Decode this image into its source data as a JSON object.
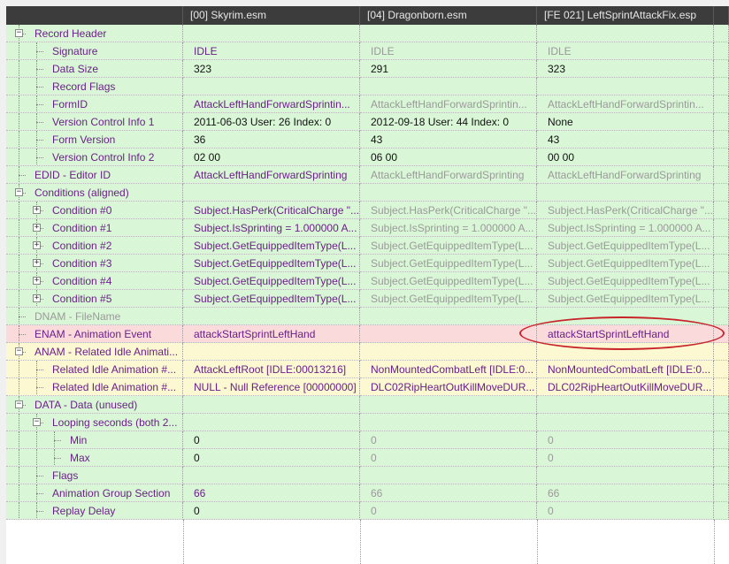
{
  "columns": [
    "",
    "[00] Skyrim.esm",
    "[04] Dragonborn.esm",
    "[FE 021] LeftSprintAttackFix.esp"
  ],
  "rows": [
    {
      "label": "Record Header",
      "indent": 0,
      "expander": "minus",
      "bg": "#d9f7d6",
      "colors": [
        "purple",
        "purple",
        "purple"
      ],
      "values": [
        "",
        "",
        ""
      ]
    },
    {
      "label": "Signature",
      "indent": 1,
      "expander": "none",
      "bg": "#d9f7d6",
      "colors": [
        "purple",
        "grey",
        "grey"
      ],
      "values": [
        "IDLE",
        "IDLE",
        "IDLE"
      ]
    },
    {
      "label": "Data Size",
      "indent": 1,
      "expander": "none",
      "bg": "#d9f7d6",
      "colors": [
        "black",
        "black",
        "black"
      ],
      "values": [
        "323",
        "291",
        "323"
      ]
    },
    {
      "label": "Record Flags",
      "indent": 1,
      "expander": "none",
      "bg": "#d9f7d6",
      "colors": [
        "purple",
        "purple",
        "purple"
      ],
      "values": [
        "",
        "",
        ""
      ]
    },
    {
      "label": "FormID",
      "indent": 1,
      "expander": "none",
      "bg": "#d9f7d6",
      "colors": [
        "purple",
        "grey",
        "grey"
      ],
      "values": [
        "AttackLeftHandForwardSprintin...",
        "AttackLeftHandForwardSprintin...",
        "AttackLeftHandForwardSprintin..."
      ]
    },
    {
      "label": "Version Control Info 1",
      "indent": 1,
      "expander": "none",
      "bg": "#d9f7d6",
      "colors": [
        "black",
        "black",
        "black"
      ],
      "values": [
        "2011-06-03 User: 26 Index: 0",
        "2012-09-18 User: 44 Index: 0",
        "None"
      ]
    },
    {
      "label": "Form Version",
      "indent": 1,
      "expander": "none",
      "bg": "#d9f7d6",
      "colors": [
        "black",
        "black",
        "black"
      ],
      "values": [
        "36",
        "43",
        "43"
      ]
    },
    {
      "label": "Version Control Info 2",
      "indent": 1,
      "expander": "none",
      "bg": "#d9f7d6",
      "colors": [
        "black",
        "black",
        "black"
      ],
      "values": [
        "02 00",
        "06 00",
        "00 00"
      ]
    },
    {
      "label": "EDID - Editor ID",
      "indent": 0,
      "expander": "none",
      "bg": "#d9f7d6",
      "colors": [
        "purple",
        "grey",
        "grey"
      ],
      "values": [
        "AttackLeftHandForwardSprinting",
        "AttackLeftHandForwardSprinting",
        "AttackLeftHandForwardSprinting"
      ]
    },
    {
      "label": "Conditions (aligned)",
      "indent": 0,
      "expander": "minus",
      "bg": "#d9f7d6",
      "colors": [
        "purple",
        "purple",
        "purple"
      ],
      "values": [
        "",
        "",
        ""
      ]
    },
    {
      "label": "Condition #0",
      "indent": 1,
      "expander": "plus",
      "bg": "#d9f7d6",
      "colors": [
        "purple",
        "grey",
        "grey"
      ],
      "values": [
        "Subject.HasPerk(CriticalCharge \"...",
        "Subject.HasPerk(CriticalCharge \"...",
        "Subject.HasPerk(CriticalCharge \"..."
      ]
    },
    {
      "label": "Condition #1",
      "indent": 1,
      "expander": "plus",
      "bg": "#d9f7d6",
      "colors": [
        "purple",
        "grey",
        "grey"
      ],
      "values": [
        "Subject.IsSprinting = 1.000000 A...",
        "Subject.IsSprinting = 1.000000 A...",
        "Subject.IsSprinting = 1.000000 A..."
      ]
    },
    {
      "label": "Condition #2",
      "indent": 1,
      "expander": "plus",
      "bg": "#d9f7d6",
      "colors": [
        "purple",
        "grey",
        "grey"
      ],
      "values": [
        "Subject.GetEquippedItemType(L...",
        "Subject.GetEquippedItemType(L...",
        "Subject.GetEquippedItemType(L..."
      ]
    },
    {
      "label": "Condition #3",
      "indent": 1,
      "expander": "plus",
      "bg": "#d9f7d6",
      "colors": [
        "purple",
        "grey",
        "grey"
      ],
      "values": [
        "Subject.GetEquippedItemType(L...",
        "Subject.GetEquippedItemType(L...",
        "Subject.GetEquippedItemType(L..."
      ]
    },
    {
      "label": "Condition #4",
      "indent": 1,
      "expander": "plus",
      "bg": "#d9f7d6",
      "colors": [
        "purple",
        "grey",
        "grey"
      ],
      "values": [
        "Subject.GetEquippedItemType(L...",
        "Subject.GetEquippedItemType(L...",
        "Subject.GetEquippedItemType(L..."
      ]
    },
    {
      "label": "Condition #5",
      "indent": 1,
      "expander": "plus",
      "bg": "#d9f7d6",
      "colors": [
        "purple",
        "grey",
        "grey"
      ],
      "values": [
        "Subject.GetEquippedItemType(L...",
        "Subject.GetEquippedItemType(L...",
        "Subject.GetEquippedItemType(L..."
      ]
    },
    {
      "label": "DNAM - FileName",
      "indent": 0,
      "expander": "none",
      "bg": "#d9f7d6",
      "labelColor": "#9a9a9a",
      "colors": [
        "purple",
        "purple",
        "purple"
      ],
      "values": [
        "",
        "",
        ""
      ]
    },
    {
      "label": "ENAM - Animation Event",
      "indent": 0,
      "expander": "none",
      "bg": "#fadadb",
      "colors": [
        "purple",
        "purple",
        "purple"
      ],
      "values": [
        "attackStartSprintLeftHand",
        "",
        "attackStartSprintLeftHand"
      ]
    },
    {
      "label": "ANAM - Related Idle Animati...",
      "indent": 0,
      "expander": "minus",
      "bg": "#fbf8d2",
      "colors": [
        "purple",
        "purple",
        "purple"
      ],
      "values": [
        "",
        "",
        ""
      ]
    },
    {
      "label": "Related Idle Animation #...",
      "indent": 1,
      "expander": "none",
      "bg": "#fbf8d2",
      "colors": [
        "purple",
        "purple",
        "purple"
      ],
      "values": [
        "AttackLeftRoot [IDLE:00013216]",
        "NonMountedCombatLeft [IDLE:0...",
        "NonMountedCombatLeft [IDLE:0..."
      ]
    },
    {
      "label": "Related Idle Animation #...",
      "indent": 1,
      "expander": "none",
      "bg": "#fbf8d2",
      "colors": [
        "purple",
        "purple",
        "purple"
      ],
      "values": [
        "NULL - Null Reference [00000000]",
        "DLC02RipHeartOutKillMoveDUR...",
        "DLC02RipHeartOutKillMoveDUR..."
      ]
    },
    {
      "label": "DATA - Data (unused)",
      "indent": 0,
      "expander": "minus",
      "bg": "#d9f7d6",
      "colors": [
        "purple",
        "purple",
        "purple"
      ],
      "values": [
        "",
        "",
        ""
      ]
    },
    {
      "label": "Looping seconds (both 2...",
      "indent": 1,
      "expander": "minus",
      "bg": "#d9f7d6",
      "colors": [
        "purple",
        "purple",
        "purple"
      ],
      "values": [
        "",
        "",
        ""
      ]
    },
    {
      "label": "Min",
      "indent": 2,
      "expander": "none",
      "bg": "#d9f7d6",
      "colors": [
        "black",
        "grey",
        "grey"
      ],
      "values": [
        "0",
        "0",
        "0"
      ]
    },
    {
      "label": "Max",
      "indent": 2,
      "expander": "none",
      "bg": "#d9f7d6",
      "colors": [
        "black",
        "grey",
        "grey"
      ],
      "values": [
        "0",
        "0",
        "0"
      ]
    },
    {
      "label": "Flags",
      "indent": 1,
      "expander": "none",
      "bg": "#d9f7d6",
      "colors": [
        "purple",
        "purple",
        "purple"
      ],
      "values": [
        "",
        "",
        ""
      ]
    },
    {
      "label": "Animation Group Section",
      "indent": 1,
      "expander": "none",
      "bg": "#d9f7d6",
      "colors": [
        "purple",
        "grey",
        "grey"
      ],
      "values": [
        "66",
        "66",
        "66"
      ]
    },
    {
      "label": "Replay Delay",
      "indent": 1,
      "expander": "none",
      "bg": "#d9f7d6",
      "colors": [
        "black",
        "grey",
        "grey"
      ],
      "values": [
        "0",
        "0",
        "0"
      ]
    }
  ],
  "highlight": {
    "row": 17,
    "column": 3,
    "color": "#c8242a"
  }
}
